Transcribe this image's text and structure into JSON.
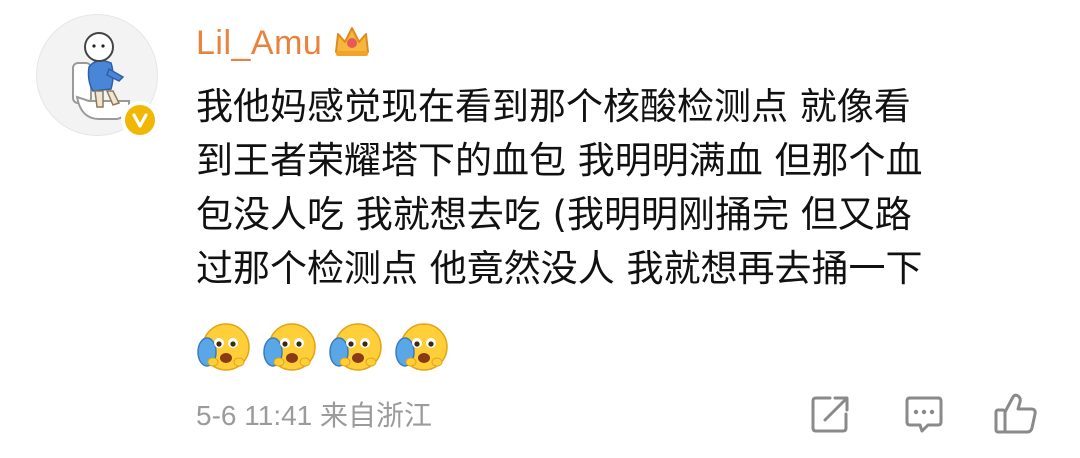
{
  "comment": {
    "username": "Lil_Amu",
    "lines": [
      "我他妈感觉现在看到那个核酸检测点 就像看",
      "到王者荣耀塔下的血包 我明明满血 但那个血",
      "包没人吃 我就想去吃 (我明明刚捅完 但又路",
      "过那个检测点 他竟然没人 我就想再去捅一下"
    ],
    "emoji_count": 4,
    "meta": "5-6 11:41 来自浙江"
  },
  "icons": {
    "avatar": "avatar-figure-on-toilet",
    "badge": "verified-v-icon",
    "crown": "crown-icon",
    "emoji": "scared-face-emoji",
    "share": "share-icon",
    "comment": "comment-icon",
    "like": "thumbs-up-icon"
  },
  "colors": {
    "username": "#e8823c",
    "badge": "#f2b705",
    "text": "#111111",
    "meta": "#9b9b9b",
    "icon": "#8a8a8a"
  }
}
